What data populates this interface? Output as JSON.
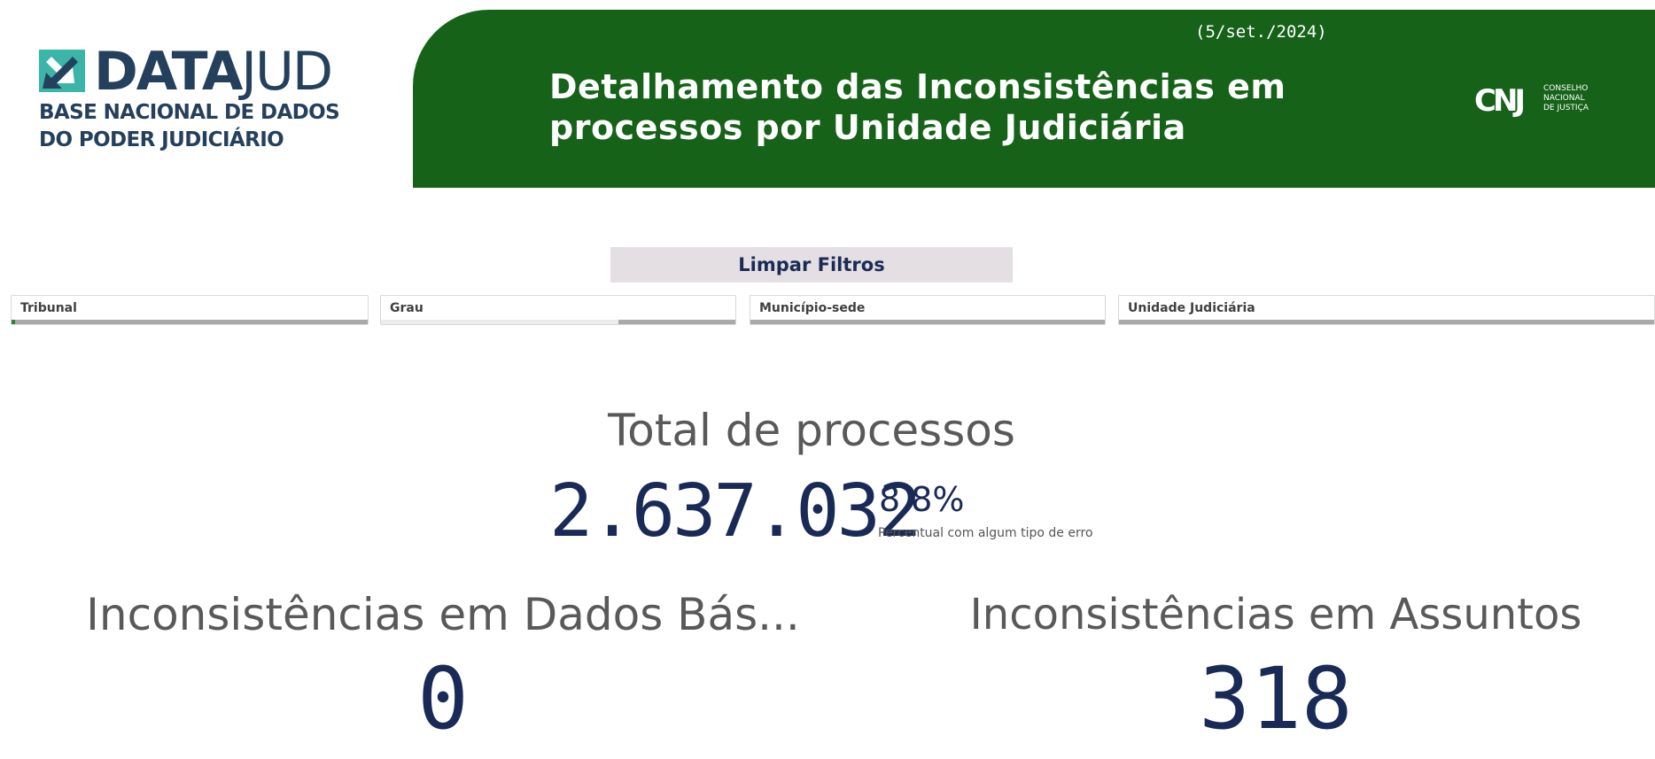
{
  "logo": {
    "word_bold": "DATA",
    "word_light": "JUD",
    "subtitle_line1": "BASE NACIONAL DE DADOS",
    "subtitle_line2": "DO PODER JUDICIÁRIO",
    "mark_colors": [
      "#3ab5a8",
      "#24405c"
    ]
  },
  "header": {
    "date": "(5/set./2024)",
    "title": "Detalhamento das Inconsistências em processos por Unidade Judiciária",
    "background_color": "#156218",
    "cnj_letters": "CNJ",
    "cnj_line1": "CONSELHO",
    "cnj_line2": "NACIONAL",
    "cnj_line3": "DE JUSTIÇA"
  },
  "toolbar": {
    "clear_filters_label": "Limpar Filtros"
  },
  "filters": [
    {
      "label": "Tribunal",
      "fill_fraction": 0.01,
      "fill_color": "#1e8c3a"
    },
    {
      "label": "Grau",
      "fill_fraction": 0.67,
      "fill_color": "#ececec"
    },
    {
      "label": "Município-sede",
      "fill_fraction": 0.0,
      "fill_color": "#ececec"
    },
    {
      "label": "Unidade Judiciária",
      "fill_fraction": 0.0,
      "fill_color": "#ececec"
    }
  ],
  "kpis": {
    "total": {
      "title": "Total de processos",
      "value": "2.637.032",
      "pct": "8,8%",
      "pct_label": "Percentual com algum tipo de erro"
    },
    "dados_basicos": {
      "title": "Inconsistências em Dados Bás...",
      "value": "0"
    },
    "assuntos": {
      "title": "Inconsistências em Assuntos",
      "value": "318"
    }
  },
  "colors": {
    "accent_navy": "#1a2a57",
    "title_gray": "#595959"
  }
}
